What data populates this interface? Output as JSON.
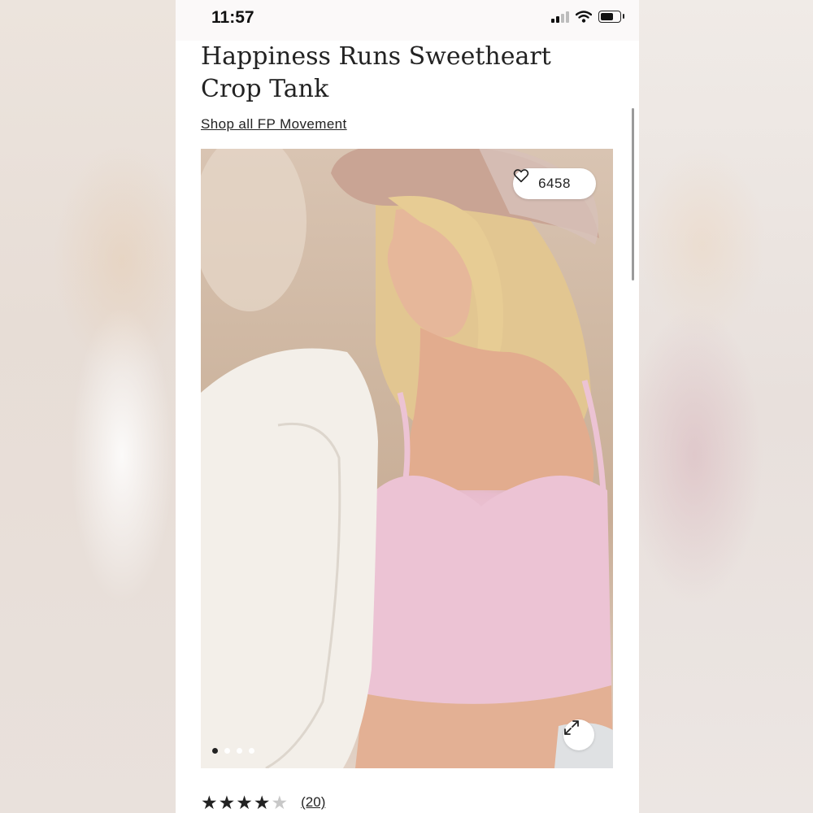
{
  "status_bar": {
    "time": "11:57"
  },
  "product": {
    "title": "Happiness Runs Sweetheart Crop Tank",
    "shop_link": "Shop all FP Movement",
    "like_count": "6458",
    "gallery": {
      "total_images": 4,
      "active_index": 1
    },
    "rating": {
      "stars": 4,
      "max": 5,
      "review_count": "(20)"
    }
  },
  "icons": [
    "signal-icon",
    "wifi-icon",
    "battery-icon",
    "heart-icon",
    "expand-icon",
    "star-icon"
  ],
  "colors": {
    "text": "#222222",
    "top_pink": "#e8bccd",
    "background": "#ffffff"
  }
}
